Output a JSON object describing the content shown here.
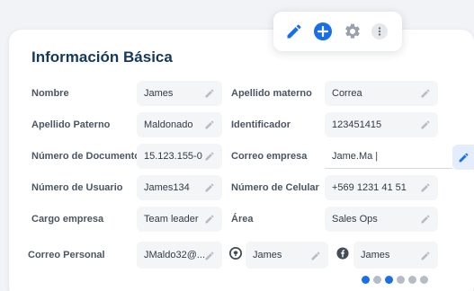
{
  "title": "Información Básica",
  "fields": {
    "nombre": {
      "label": "Nombre",
      "value": "James"
    },
    "apellido_materno": {
      "label": "Apellido materno",
      "value": "Correa"
    },
    "apellido_paterno": {
      "label": "Apellido Paterno",
      "value": "Maldonado"
    },
    "identificador": {
      "label": "Identificador",
      "value": "123451415"
    },
    "numero_documento": {
      "label": "Número de Documento",
      "value": "15.123.155-0"
    },
    "correo_empresa": {
      "label": "Correo empresa",
      "value": "Jame.Ma"
    },
    "numero_usuario": {
      "label": "Número de Usuario",
      "value": "James134"
    },
    "numero_celular": {
      "label": "Número de Celular",
      "value": "+569 1231 41 51"
    },
    "cargo_empresa": {
      "label": "Cargo empresa",
      "value": "Team leader"
    },
    "area": {
      "label": "Área",
      "value": "Sales Ops"
    },
    "correo_personal": {
      "label": "Correo Personal",
      "value": "JMaldo32@..."
    },
    "github": {
      "value": "James"
    },
    "facebook": {
      "value": "James"
    }
  },
  "colors": {
    "accent": "#1a6fe8",
    "title": "#16385a",
    "field_bg": "#f4f5f7"
  },
  "icons": {
    "toolbar": [
      "pencil-icon",
      "plus-circle-icon",
      "gear-icon",
      "more-icon"
    ],
    "field_edit": "pencil-icon",
    "social": [
      "github-icon",
      "facebook-icon"
    ],
    "footer_dots": [
      "github-icon",
      "dribbble-icon",
      "facebook-icon",
      "linkedin-icon",
      "chat-icon",
      "instagram-icon"
    ]
  }
}
